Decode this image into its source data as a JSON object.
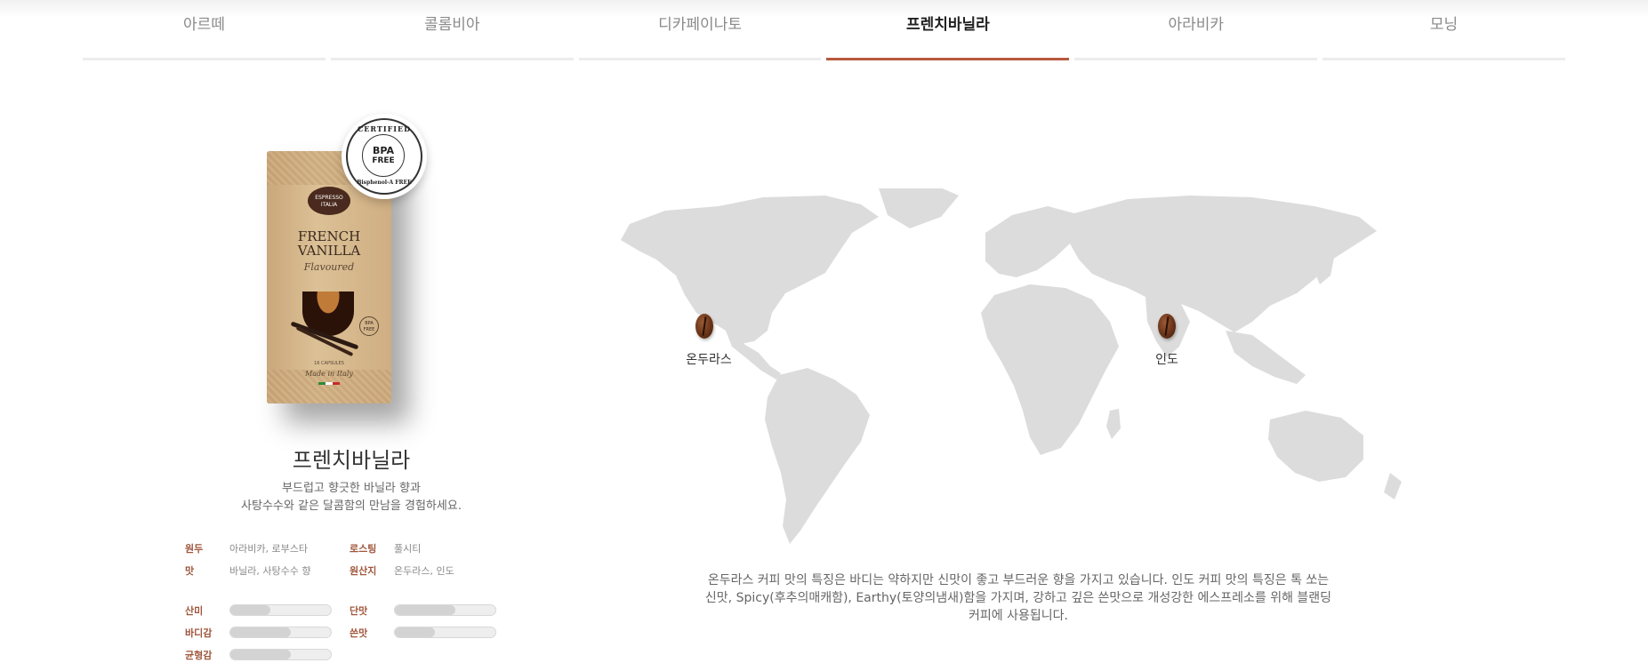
{
  "tabs": [
    {
      "label": "아르떼",
      "active": false
    },
    {
      "label": "콜롬비아",
      "active": false
    },
    {
      "label": "디카페이나토",
      "active": false
    },
    {
      "label": "프렌치바닐라",
      "active": true
    },
    {
      "label": "아라비카",
      "active": false
    },
    {
      "label": "모닝",
      "active": false
    }
  ],
  "colors": {
    "accent": "#b85a3e",
    "label": "#a0563c"
  },
  "product": {
    "title": "프렌치바닐라",
    "description": [
      "부드럽고 향긋한 바닐라 향과",
      "사탕수수와 같은 달콤함의 만남을 경험하세요."
    ],
    "package": {
      "brand": "ESPRESSO ITALIA",
      "name": "FRENCH VANILLA",
      "sub": "Flavoured",
      "capsules": "16 CAPSULES",
      "origin": "Made in Italy",
      "seal": "BPA FREE"
    },
    "badge": {
      "top": "CERTIFIED",
      "main": "BPA",
      "main2": "FREE",
      "bottom": "Bisphenol-A FREE"
    },
    "specs": [
      {
        "label": "원두",
        "value": "아라비카, 로부스타"
      },
      {
        "label": "로스팅",
        "value": "풀시티"
      },
      {
        "label": "맛",
        "value": "바닐라, 사탕수수 향"
      },
      {
        "label": "원산지",
        "value": "온두라스, 인도"
      }
    ],
    "ratings": [
      {
        "label": "산미",
        "level": 0.4
      },
      {
        "label": "단맛",
        "level": 0.6
      },
      {
        "label": "바디감",
        "level": 0.6
      },
      {
        "label": "쓴맛",
        "level": 0.4
      },
      {
        "label": "균형감",
        "level": 0.6
      }
    ]
  },
  "map": {
    "origins": [
      {
        "label": "온두라스"
      },
      {
        "label": "인도"
      }
    ],
    "description": "온두라스 커피 맛의 특징은 바디는 약하지만 신맛이 좋고 부드러운 향을 가지고 있습니다. 인도 커피 맛의 특징은 톡 쏘는 신맛, Spicy(후추의매캐함), Earthy(토양의냄새)함을 가지며, 강하고 깊은 쓴맛으로 개성강한 에스프레소를 위해 블랜딩 커피에 사용됩니다."
  }
}
